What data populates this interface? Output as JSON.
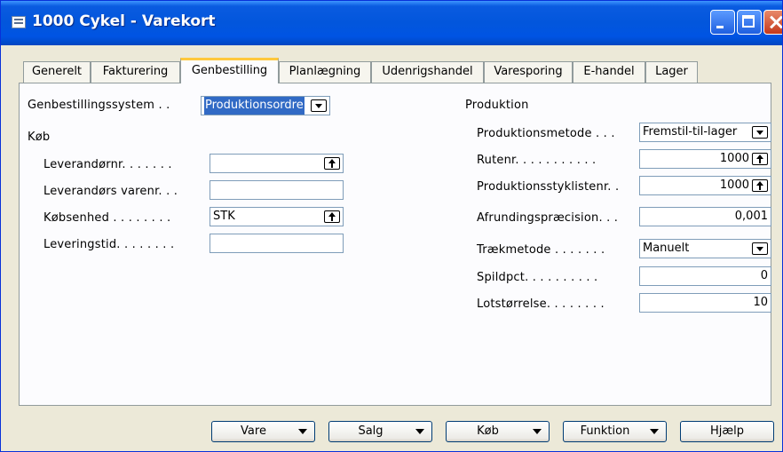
{
  "window": {
    "title": "1000 Cykel - Varekort"
  },
  "tabs": [
    {
      "label": "Generelt"
    },
    {
      "label": "Fakturering"
    },
    {
      "label": "Genbestilling",
      "active": true
    },
    {
      "label": "Planlægning"
    },
    {
      "label": "Udenrigshandel"
    },
    {
      "label": "Varesporing"
    },
    {
      "label": "E-handel"
    },
    {
      "label": "Lager"
    }
  ],
  "left": {
    "reorder_system_label": "Genbestillingssystem  . .",
    "reorder_system_value": "Produktionsordre",
    "section_title": "Køb",
    "vendor_no_label": "Leverandørnr. . . . . . .",
    "vendor_no_value": "",
    "vendor_item_no_label": "Leverandørs varenr. . .",
    "vendor_item_no_value": "",
    "purch_unit_label": "Købsenhed . . . . . . . .",
    "purch_unit_value": "STK",
    "lead_time_label": "Leveringstid. . . . . . . .",
    "lead_time_value": ""
  },
  "right": {
    "section_title": "Produktion",
    "prod_method_label": "Produktionsmetode . . .",
    "prod_method_value": "Fremstil-til-lager",
    "routing_no_label": "Rutenr. . . . . . . . . . .",
    "routing_no_value": "1000",
    "prod_bom_label": "Produktionsstyklistenr.  .",
    "prod_bom_value": "1000",
    "rounding_label": "Afrundingspræcision. . .",
    "rounding_value": "0,001",
    "flushing_label": "Trækmetode . . . . . . .",
    "flushing_value": "Manuelt",
    "scrap_label": "Spildpct. . . . . . . . . .",
    "scrap_value": "0",
    "lot_size_label": "Lotstørrelse. . . . . . . .",
    "lot_size_value": "10"
  },
  "footer": {
    "item_btn": "Vare",
    "sales_btn": "Salg",
    "purchase_btn": "Køb",
    "function_btn": "Funktion",
    "help_btn": "Hjælp"
  },
  "colors": {
    "titlebar": "#0054E3",
    "window_bg": "#ECE9D8",
    "panel_bg": "#FCFCFE",
    "selection": "#316AC5",
    "active_tab_accent": "#FFC83C"
  }
}
